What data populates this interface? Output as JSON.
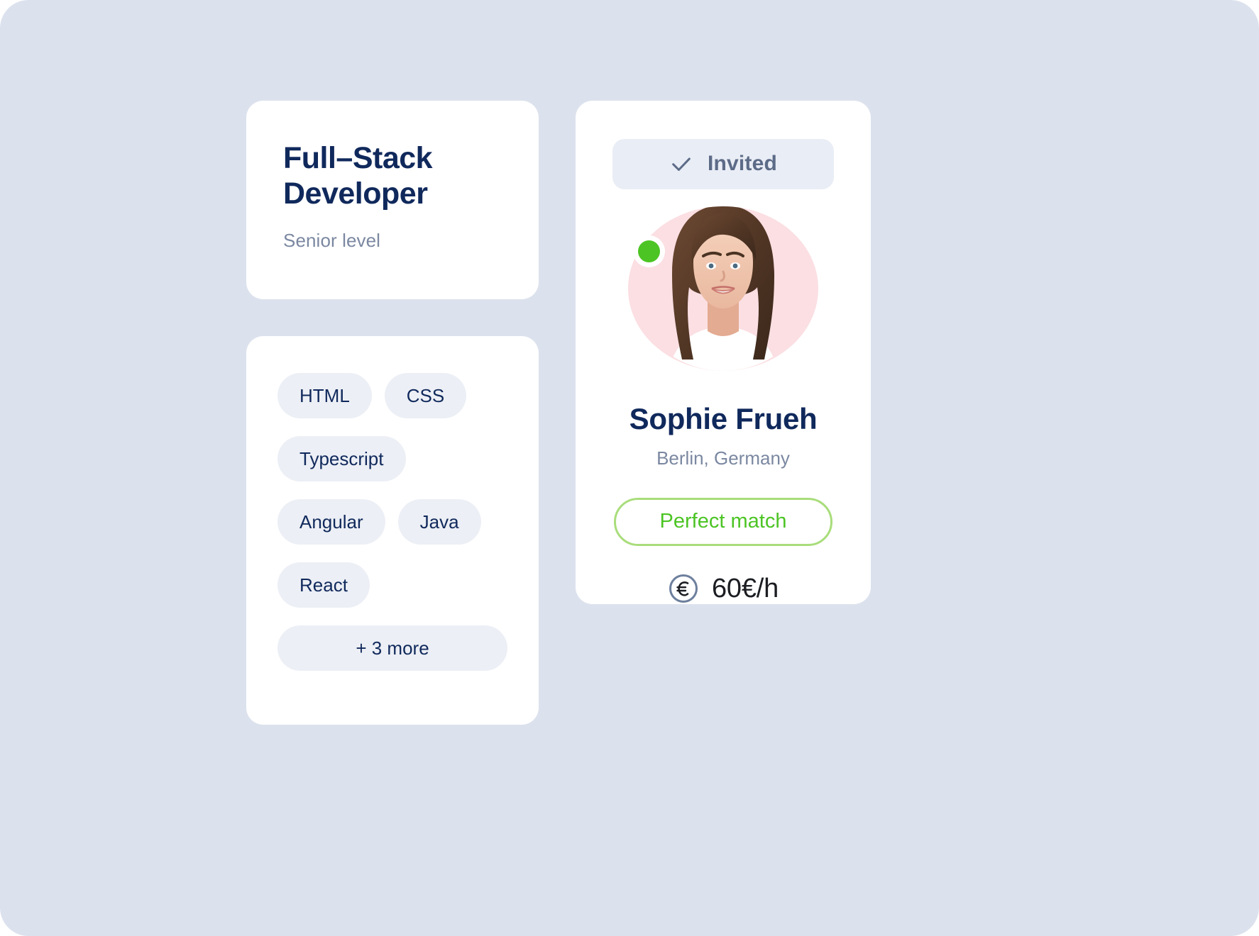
{
  "theme": {
    "page_background": "#ffffff",
    "panel_background": "#dce2ed",
    "card_background": "#ffffff",
    "navy": "#10295c",
    "muted_text": "#7b88a1",
    "chip_background": "#eceff5",
    "badge_background": "#e9edf5",
    "badge_text": "#5c6b87",
    "accent_green": "#4cc424",
    "accent_green_border": "#a9dd7c",
    "avatar_background": "#fbdfe3"
  },
  "role_card": {
    "title": "Full–Stack Developer",
    "title_line_1": "Full–Stack",
    "title_line_2": "Developer",
    "subtitle": "Senior level"
  },
  "skills_card": {
    "chips": [
      {
        "label": "HTML",
        "wide": false
      },
      {
        "label": "CSS",
        "wide": false
      },
      {
        "label": "Typescript",
        "wide": false
      },
      {
        "label": "Angular",
        "wide": false
      },
      {
        "label": "Java",
        "wide": false
      },
      {
        "label": "React",
        "wide": false
      },
      {
        "label": "+ 3 more",
        "wide": true
      }
    ],
    "hidden_count": 3
  },
  "candidate_card": {
    "status_badge": {
      "label": "Invited",
      "icon": "check-icon"
    },
    "avatar": {
      "icon": "avatar",
      "online_indicator": "online-status-dot",
      "online": true
    },
    "name": "Sophie Frueh",
    "location": "Berlin, Germany",
    "match_button_label": "Perfect match",
    "rate": {
      "icon": "euro-coin-icon",
      "value": "60€/h"
    }
  }
}
